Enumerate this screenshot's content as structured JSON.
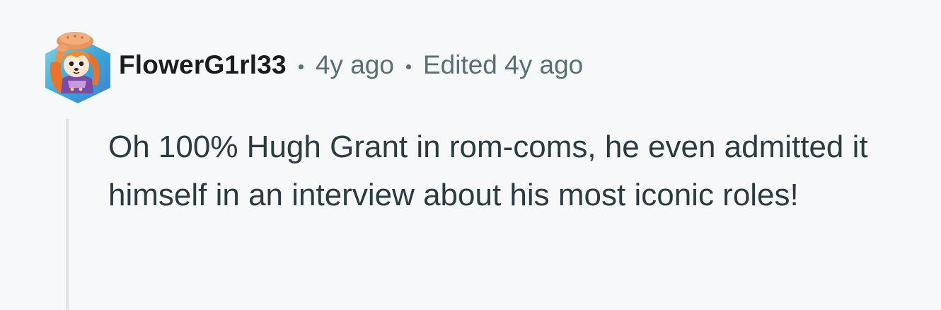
{
  "comment": {
    "author": "FlowerG1rl33",
    "timestamp": "4y ago",
    "edited": "Edited 4y ago",
    "body": "Oh 100% Hugh Grant in rom-coms, he even admitted it himself in an interview about his most iconic roles!",
    "avatar_icon": "snoo-avatar-icon"
  },
  "colors": {
    "background": "#f7f8fa",
    "author_text": "#1c1c1c",
    "meta_text": "#576f76",
    "body_text": "#2a3c42",
    "thread_line": "#dfe2e6"
  }
}
